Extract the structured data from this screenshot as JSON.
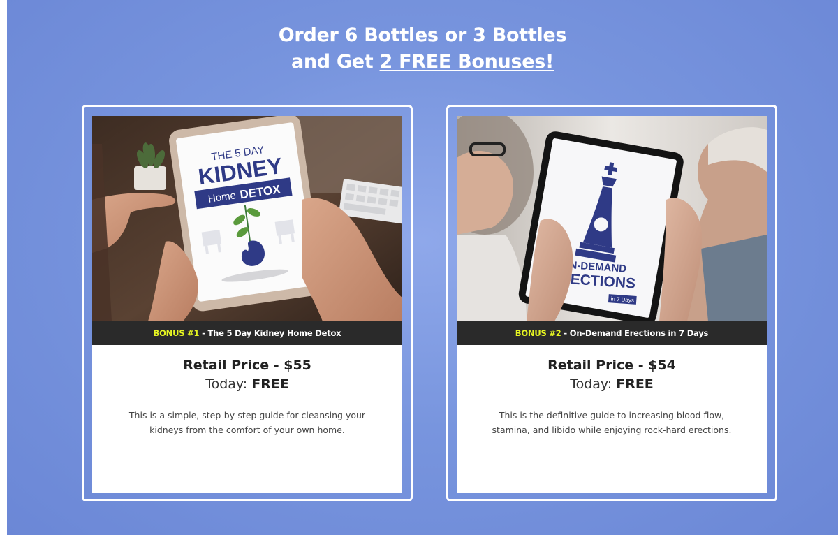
{
  "header": {
    "line1": "Order 6 Bottles or 3 Bottles",
    "line2_prefix": "and Get ",
    "line2_link": "2 FREE Bonuses!"
  },
  "bonuses": [
    {
      "tag": "BONUS #1",
      "title": " - The 5 Day Kidney Home Detox",
      "price_label": "Retail Price - ",
      "price_value": "$55",
      "today_label": "Today: ",
      "today_value": "FREE",
      "description": "This is a simple, step-by-step guide for cleansing your kidneys from the comfort of your own home.",
      "cover": {
        "line1": "THE 5 DAY",
        "line2": "KIDNEY",
        "line3a": "Home",
        "line3b": "DETOX"
      }
    },
    {
      "tag": "BONUS #2",
      "title": " - On-Demand Erections in 7 Days",
      "price_label": "Retail Price - ",
      "price_value": "$54",
      "today_label": "Today: ",
      "today_value": "FREE",
      "description": "This is the definitive guide to increasing blood flow, stamina, and libido while enjoying rock-hard erections.",
      "cover": {
        "line1": "ON-DEMAND",
        "line2": "ERECTIONS",
        "line3": "in 7 Days"
      }
    }
  ],
  "colors": {
    "background": "#7895de",
    "caption_bg": "#2a2a2a",
    "bonus_tag": "#e6f522",
    "cover_navy": "#2f3a86"
  }
}
